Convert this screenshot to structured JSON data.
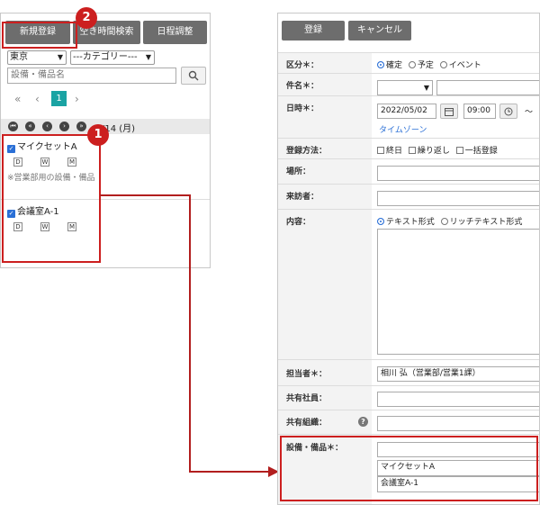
{
  "left": {
    "buttons": [
      "新規登録",
      "空き時間検索",
      "日程調整"
    ],
    "location_select": "東京",
    "category_select": "---カテゴリー---",
    "search_placeholder": "設備・備品名",
    "pager": {
      "first": "«",
      "prev": "‹",
      "current": "1",
      "next": "›"
    },
    "date": "/14 (月)",
    "resources": [
      {
        "name": "マイクセットA",
        "note": "※営業部用の設備・備品"
      },
      {
        "name": "会議室A-1"
      }
    ],
    "view_buttons": [
      "D",
      "W",
      "M"
    ],
    "callouts": [
      "1",
      "2"
    ]
  },
  "right": {
    "buttons": {
      "register": "登録",
      "cancel": "キャンセル"
    },
    "fields": {
      "category": {
        "label": "区分＊：",
        "options": [
          "確定",
          "予定",
          "イベント"
        ]
      },
      "subject": {
        "label": "件名＊："
      },
      "datetime": {
        "label": "日時＊：",
        "date": "2022/05/02",
        "time": "09:00",
        "tilde": "～",
        "timezone_link": "タイムゾーン"
      },
      "method": {
        "label": "登録方法：",
        "options": [
          "終日",
          "繰り返し",
          "一括登録"
        ]
      },
      "place": {
        "label": "場所："
      },
      "visitor": {
        "label": "来訪者："
      },
      "content": {
        "label": "内容：",
        "options": [
          "テキスト形式",
          "リッチテキスト形式"
        ]
      },
      "person": {
        "label": "担当者＊：",
        "value": "相川 弘（営業部/営業1課）"
      },
      "shared_staff": {
        "label": "共有社員："
      },
      "shared_org": {
        "label": "共有組織："
      },
      "equipment": {
        "label": "設備・備品＊：",
        "items": [
          "マイクセットA",
          "会議室A-1"
        ]
      }
    }
  },
  "colors": {
    "accent": "#cc1f1f",
    "button": "#6d6d6d",
    "teal": "#1aa3a3",
    "check": "#2a6fd6"
  }
}
